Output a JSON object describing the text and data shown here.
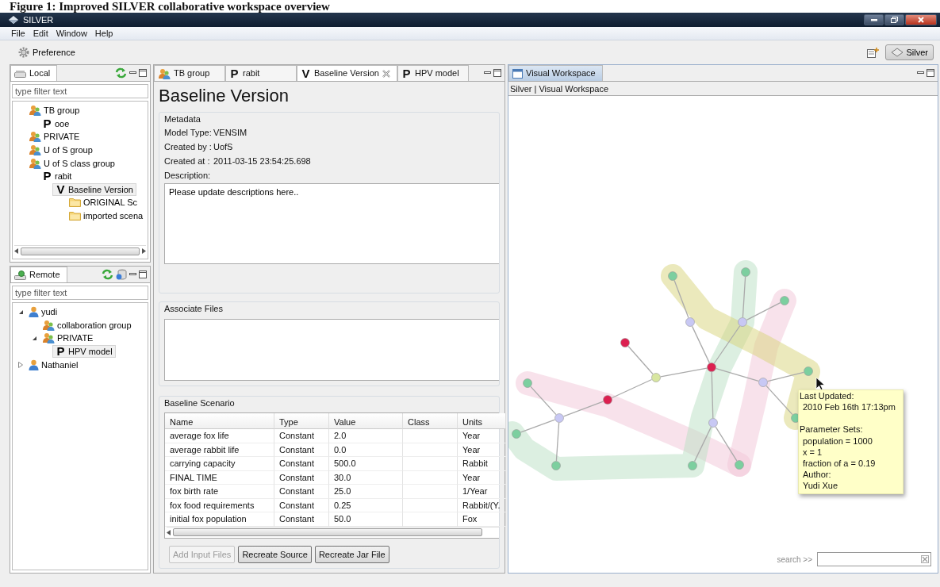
{
  "caption": "Figure 1: Improved SILVER collaborative workspace overview",
  "window": {
    "title": "SILVER"
  },
  "menu": [
    "File",
    "Edit",
    "Window",
    "Help"
  ],
  "toolbar": {
    "preference": "Preference",
    "perspective": {
      "label": "Silver",
      "selected": true
    }
  },
  "local": {
    "title": "Local",
    "filter_placeholder": "type filter text",
    "tree": [
      {
        "label": "TB group",
        "kind": "group",
        "selected": false,
        "children": [
          {
            "label": "ooe",
            "kind": "project",
            "glyph": "P",
            "selected": false
          }
        ]
      },
      {
        "label": "PRIVATE",
        "kind": "group",
        "selected": false
      },
      {
        "label": "U of S group",
        "kind": "group",
        "selected": false
      },
      {
        "label": "U of S class group",
        "kind": "group",
        "selected": false,
        "children": [
          {
            "label": "rabit",
            "kind": "project",
            "glyph": "P",
            "selected": false,
            "children": [
              {
                "label": "Baseline Version",
                "kind": "version",
                "glyph": "V",
                "selected": true,
                "children": [
                  {
                    "label": "ORIGINAL Sc",
                    "kind": "folder",
                    "selected": false
                  },
                  {
                    "label": "imported scena",
                    "kind": "folder",
                    "selected": false
                  }
                ]
              }
            ]
          }
        ]
      }
    ]
  },
  "remote": {
    "title": "Remote",
    "filter_placeholder": "type filter text",
    "tree": [
      {
        "label": "yudi",
        "kind": "user",
        "expanded": true,
        "selected": false,
        "children": [
          {
            "label": "collaboration group",
            "kind": "group",
            "selected": false
          },
          {
            "label": "PRIVATE",
            "kind": "group",
            "expanded": true,
            "selected": false,
            "children": [
              {
                "label": "HPV model",
                "kind": "project",
                "glyph": "P",
                "selected": true
              }
            ]
          }
        ]
      },
      {
        "label": "Nathaniel",
        "kind": "user",
        "expanded": false,
        "selected": false
      }
    ]
  },
  "editor": {
    "tabs": [
      {
        "label": "TB group",
        "kind": "group",
        "selected": false
      },
      {
        "label": "rabit",
        "kind": "project",
        "glyph": "P",
        "selected": false
      },
      {
        "label": "Baseline Version",
        "kind": "version",
        "glyph": "V",
        "selected": true
      },
      {
        "label": "HPV model",
        "kind": "project",
        "glyph": "P",
        "selected": false
      }
    ],
    "title": "Baseline Version",
    "metadata": {
      "legend": "Metadata",
      "fields": [
        {
          "label": "Model Type:",
          "value": "VENSIM"
        },
        {
          "label": "Created by :",
          "value": "UofS"
        },
        {
          "label": "Created at :",
          "value": "2011-03-15 23:54:25.698"
        }
      ],
      "description_label": "Description:",
      "description": "Please update descriptions here.."
    },
    "associate_files": {
      "legend": "Associate Files"
    },
    "scenario": {
      "legend": "Baseline Scenario",
      "columns": [
        "Name",
        "Type",
        "Value",
        "Class",
        "Units"
      ],
      "rows": [
        {
          "name": "average fox life",
          "type": "Constant",
          "value": "2.0",
          "units": "Year"
        },
        {
          "name": "average rabbit life",
          "type": "Constant",
          "value": "0.0",
          "units": "Year"
        },
        {
          "name": "carrying capacity",
          "type": "Constant",
          "value": "500.0",
          "units": "Rabbit"
        },
        {
          "name": "FINAL TIME",
          "type": "Constant",
          "value": "30.0",
          "units": "Year"
        },
        {
          "name": "fox birth rate",
          "type": "Constant",
          "value": "25.0",
          "units": "1/Year"
        },
        {
          "name": "fox food requirements",
          "type": "Constant",
          "value": "0.25",
          "units": "Rabbit/(Y."
        },
        {
          "name": "initial fox population",
          "type": "Constant",
          "value": "50.0",
          "units": "Fox"
        }
      ]
    },
    "buttons": [
      {
        "label": "Add Input Files",
        "disabled": true
      },
      {
        "label": "Recreate Source",
        "disabled": false
      },
      {
        "label": "Recreate Jar File",
        "disabled": false
      }
    ]
  },
  "workspace": {
    "tab": {
      "label": "Visual Workspace",
      "selected": true
    },
    "breadcrumb": "Silver | Visual Workspace",
    "tooltip": [
      {
        "heading": "Last Updated:",
        "lines": [
          "2010 Feb 16th 17:13pm"
        ]
      },
      {
        "heading": "Parameter Sets:",
        "lines": [
          "population = 1000",
          "x = 1",
          "fraction of a = 0.19",
          "Author:",
          "Yudi Xue"
        ]
      }
    ],
    "search_label": "search >>"
  }
}
